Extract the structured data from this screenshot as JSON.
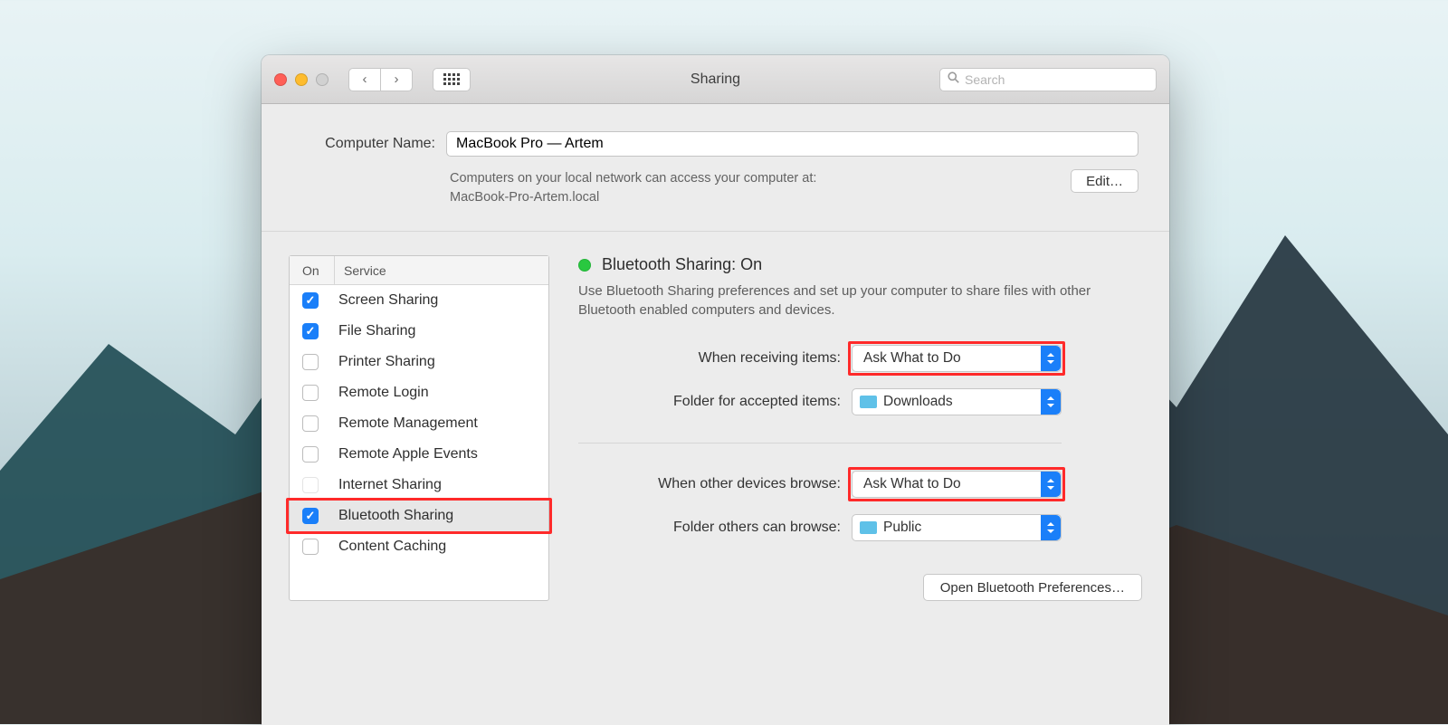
{
  "window": {
    "title": "Sharing",
    "search_placeholder": "Search"
  },
  "computer_name": {
    "label": "Computer Name:",
    "value": "MacBook Pro — Artem",
    "description_line1": "Computers on your local network can access your computer at:",
    "description_line2": "MacBook-Pro-Artem.local",
    "edit": "Edit…"
  },
  "services": {
    "col_on": "On",
    "col_service": "Service",
    "items": [
      {
        "label": "Screen Sharing",
        "on": true
      },
      {
        "label": "File Sharing",
        "on": true
      },
      {
        "label": "Printer Sharing",
        "on": false
      },
      {
        "label": "Remote Login",
        "on": false
      },
      {
        "label": "Remote Management",
        "on": false
      },
      {
        "label": "Remote Apple Events",
        "on": false
      },
      {
        "label": "Internet Sharing",
        "on": false,
        "disabled": true
      },
      {
        "label": "Bluetooth Sharing",
        "on": true,
        "selected": true,
        "highlight": true
      },
      {
        "label": "Content Caching",
        "on": false
      }
    ]
  },
  "detail": {
    "title": "Bluetooth Sharing: On",
    "description": "Use Bluetooth Sharing preferences and set up your computer to share files with other Bluetooth enabled computers and devices.",
    "when_receiving_label": "When receiving items:",
    "when_receiving_value": "Ask What to Do",
    "folder_accepted_label": "Folder for accepted items:",
    "folder_accepted_value": "Downloads",
    "when_browse_label": "When other devices browse:",
    "when_browse_value": "Ask What to Do",
    "folder_browse_label": "Folder others can browse:",
    "folder_browse_value": "Public",
    "open_prefs": "Open Bluetooth Preferences…"
  }
}
